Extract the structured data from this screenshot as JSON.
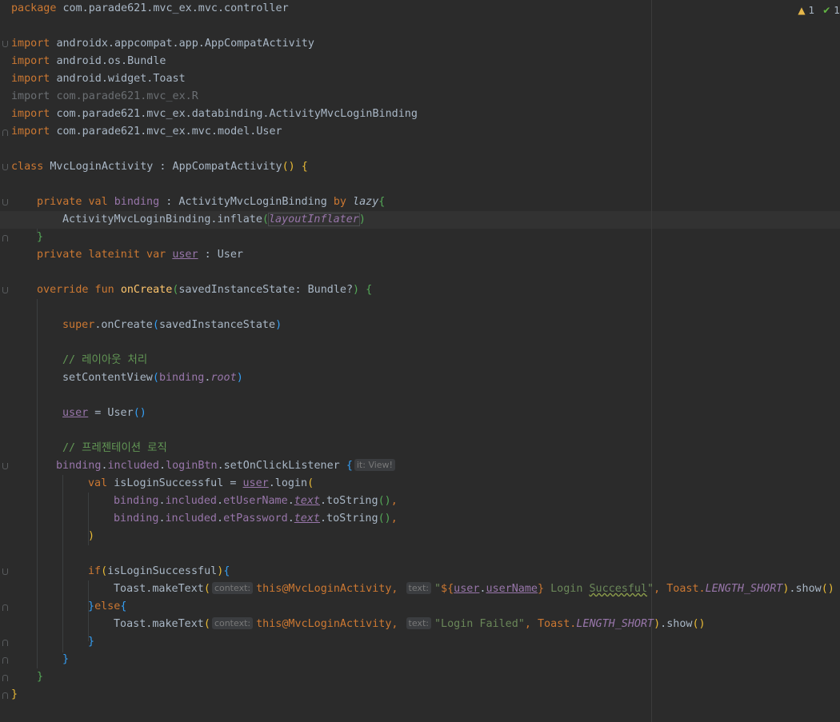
{
  "editor": {
    "line1": {
      "a": "package ",
      "b": "com.parade621.mvc_ex.mvc.controller"
    },
    "line3": {
      "a": "import ",
      "b": "androidx.appcompat.app.AppCompatActivity"
    },
    "line4": {
      "a": "import ",
      "b": "android.os.Bundle"
    },
    "line5": {
      "a": "import ",
      "b": "android.widget.Toast"
    },
    "line6": {
      "a": "import ",
      "b": "com.parade621.mvc_ex.R"
    },
    "line7": {
      "a": "import ",
      "b": "com.parade621.mvc_ex.databinding.ActivityMvcLoginBinding"
    },
    "line8": {
      "a": "import ",
      "b": "com.parade621.mvc_ex.mvc.model.User"
    },
    "line10": {
      "a": "class ",
      "b": "MvcLoginActivity : AppCompatActivity",
      "c": "()",
      "d": " ",
      "e": "{"
    },
    "line12": {
      "a": "private val ",
      "b": "binding",
      "c": " : ActivityMvcLoginBinding ",
      "d": "by ",
      "e": "lazy",
      "f": "{"
    },
    "line13": {
      "a": "ActivityMvcLoginBinding.inflate",
      "b": "(",
      "c": "layoutInflater",
      "d": ")"
    },
    "line14": {
      "a": "}"
    },
    "line15": {
      "a": "private lateinit var ",
      "b": "user",
      "c": " : User"
    },
    "line17": {
      "a": "override fun ",
      "b": "onCreate",
      "c": "(",
      "d": "savedInstanceState: Bundle?",
      "e": ")",
      "f": " ",
      "g": "{"
    },
    "line19": {
      "a": "super",
      "b": ".onCreate",
      "c": "(",
      "d": "savedInstanceState",
      "e": ")"
    },
    "line21": {
      "a": "// 레이아웃 처리"
    },
    "line22": {
      "a": "setContentView",
      "b": "(",
      "c": "binding",
      "d": ".",
      "e": "root",
      "f": ")"
    },
    "line24": {
      "a": "user",
      "b": " = User",
      "c": "()"
    },
    "line26": {
      "a": "// 프레젠테이션 로직"
    },
    "line27": {
      "a": "binding",
      "b": ".",
      "c": "included",
      "d": ".",
      "e": "loginBtn",
      "f": ".setOnClickListener ",
      "g": "{",
      "hint": "it: View!"
    },
    "line28": {
      "a": "val ",
      "b": "isLoginSuccessful = ",
      "c": "user",
      "d": ".login",
      "e": "("
    },
    "line29": {
      "a": "binding",
      "b": ".",
      "c": "included",
      "d": ".",
      "e": "etUserName",
      "f": ".",
      "g": "text",
      "h": ".toString",
      "i": "()",
      "j": ","
    },
    "line30": {
      "a": "binding",
      "b": ".",
      "c": "included",
      "d": ".",
      "e": "etPassword",
      "f": ".",
      "g": "text",
      "h": ".toString",
      "i": "()",
      "j": ","
    },
    "line31": {
      "a": ")"
    },
    "line33": {
      "a": "if",
      "b": "(",
      "c": "isLoginSuccessful",
      "d": ")",
      "e": "{"
    },
    "line34": {
      "a": "Toast.makeText",
      "b": "(",
      "hint1": "context:",
      "c": "this",
      "d": "@MvcLoginActivity",
      "e": ", ",
      "hint2": "text:",
      "f": "\"",
      "g": "${",
      "h": "user",
      "i": ".",
      "j": "userName",
      "k": "}",
      "l": " Login ",
      "m": "Succesful",
      "n": "\"",
      "o": ", Toast.",
      "p": "LENGTH_SHORT",
      "q": ")",
      "r": ".show",
      "s": "()"
    },
    "line35": {
      "a": "}",
      "b": "else",
      "c": "{"
    },
    "line36": {
      "a": "Toast.makeText",
      "b": "(",
      "hint1": "context:",
      "c": "this",
      "d": "@MvcLoginActivity",
      "e": ", ",
      "hint2": "text:",
      "f": "\"Login Failed\"",
      "g": ", Toast.",
      "h": "LENGTH_SHORT",
      "i": ")",
      "j": ".show",
      "k": "()"
    },
    "line37": {
      "a": "}"
    },
    "line38": {
      "a": "}"
    },
    "line39": {
      "a": "}"
    },
    "line40": {
      "a": "}"
    }
  },
  "status": {
    "warnings": "1",
    "checks": "1"
  },
  "icons": {
    "warning": "warning-triangle-icon",
    "check": "checkmark-icon"
  }
}
